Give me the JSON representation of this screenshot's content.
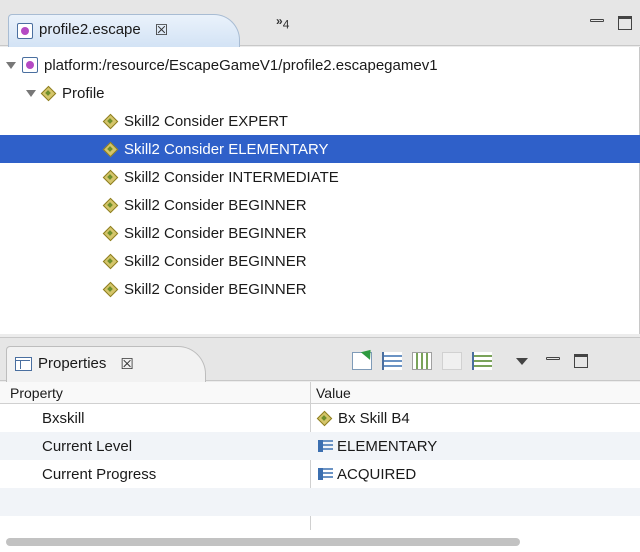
{
  "editor": {
    "tab_label": "profile2.escape",
    "tab_close": "☒",
    "overflow_marker": "»",
    "overflow_count": "4",
    "tree": {
      "root_label": "platform:/resource/EscapeGameV1/profile2.escapegamev1",
      "profile_label": "Profile",
      "items": [
        {
          "label": "Skill2 Consider EXPERT"
        },
        {
          "label": "Skill2 Consider ELEMENTARY",
          "selected": true
        },
        {
          "label": "Skill2 Consider INTERMEDIATE"
        },
        {
          "label": "Skill2 Consider BEGINNER"
        },
        {
          "label": "Skill2 Consider BEGINNER"
        },
        {
          "label": "Skill2 Consider BEGINNER"
        },
        {
          "label": "Skill2 Consider BEGINNER"
        }
      ]
    }
  },
  "properties": {
    "tab_label": "Properties",
    "tab_close": "☒",
    "columns": {
      "property": "Property",
      "value": "Value"
    },
    "rows": [
      {
        "name": "Bxskill",
        "value": "Bx Skill B4",
        "value_icon": "diamond-icon"
      },
      {
        "name": "Current Level",
        "value": "ELEMENTARY",
        "value_icon": "enum-literal-icon"
      },
      {
        "name": "Current Progress",
        "value": "ACQUIRED",
        "value_icon": "enum-literal-icon"
      }
    ]
  },
  "colors": {
    "selection": "#2f60c9",
    "tab_active": "#d3e3f5"
  }
}
